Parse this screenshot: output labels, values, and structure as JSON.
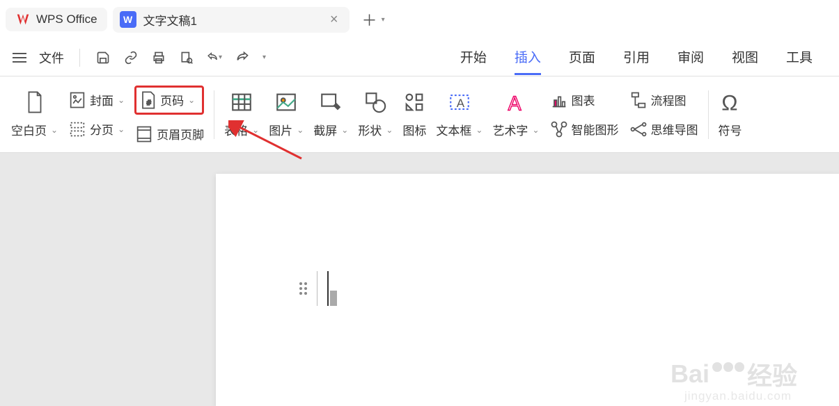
{
  "titlebar": {
    "app_name": "WPS Office",
    "doc_title": "文字文稿1",
    "doc_icon_letter": "W"
  },
  "menubar": {
    "file_label": "文件",
    "tabs": [
      "开始",
      "插入",
      "页面",
      "引用",
      "审阅",
      "视图",
      "工具"
    ],
    "active_tab": "插入"
  },
  "ribbon": {
    "blank_page": "空白页",
    "cover": "封面",
    "page_number": "页码",
    "page_break": "分页",
    "header_footer": "页眉页脚",
    "table": "表格",
    "picture": "图片",
    "screenshot": "截屏",
    "shape": "形状",
    "icon": "图标",
    "textbox": "文本框",
    "wordart": "艺术字",
    "chart": "图表",
    "smartart": "智能图形",
    "flowchart": "流程图",
    "mindmap": "思维导图",
    "symbol": "符号"
  },
  "watermark": {
    "brand": "Bai",
    "brand2": "经验",
    "url": "jingyan.baidu.com"
  },
  "annotation": {
    "highlighted_button": "页码",
    "arrow_color": "#e03030"
  }
}
